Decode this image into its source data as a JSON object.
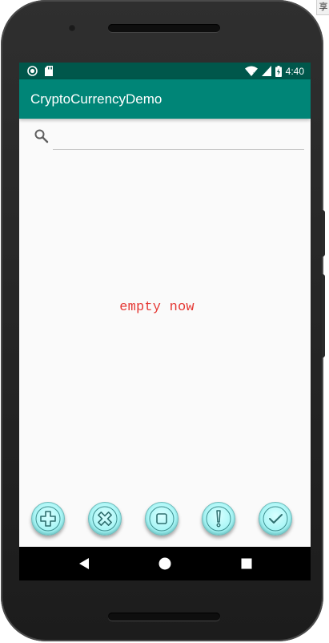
{
  "system": {
    "corner_glyph": "享"
  },
  "status_bar": {
    "time": "4:40",
    "left_icons": [
      "notification-dot-icon",
      "sd-card-icon"
    ],
    "right_icons": [
      "wifi-icon",
      "cell-signal-icon",
      "battery-charging-icon"
    ]
  },
  "app_bar": {
    "title": "CryptoCurrencyDemo",
    "color": "#008577",
    "status_color": "#00574b"
  },
  "search": {
    "icon": "search-icon",
    "value": "",
    "placeholder": ""
  },
  "content": {
    "empty_message": "empty now",
    "empty_color": "#e53935"
  },
  "fabs": [
    {
      "icon": "plus-icon"
    },
    {
      "icon": "cancel-icon"
    },
    {
      "icon": "stop-icon"
    },
    {
      "icon": "alert-icon"
    },
    {
      "icon": "check-icon"
    }
  ],
  "nav_bar": {
    "buttons": [
      "back-icon",
      "home-icon",
      "recents-icon"
    ]
  }
}
